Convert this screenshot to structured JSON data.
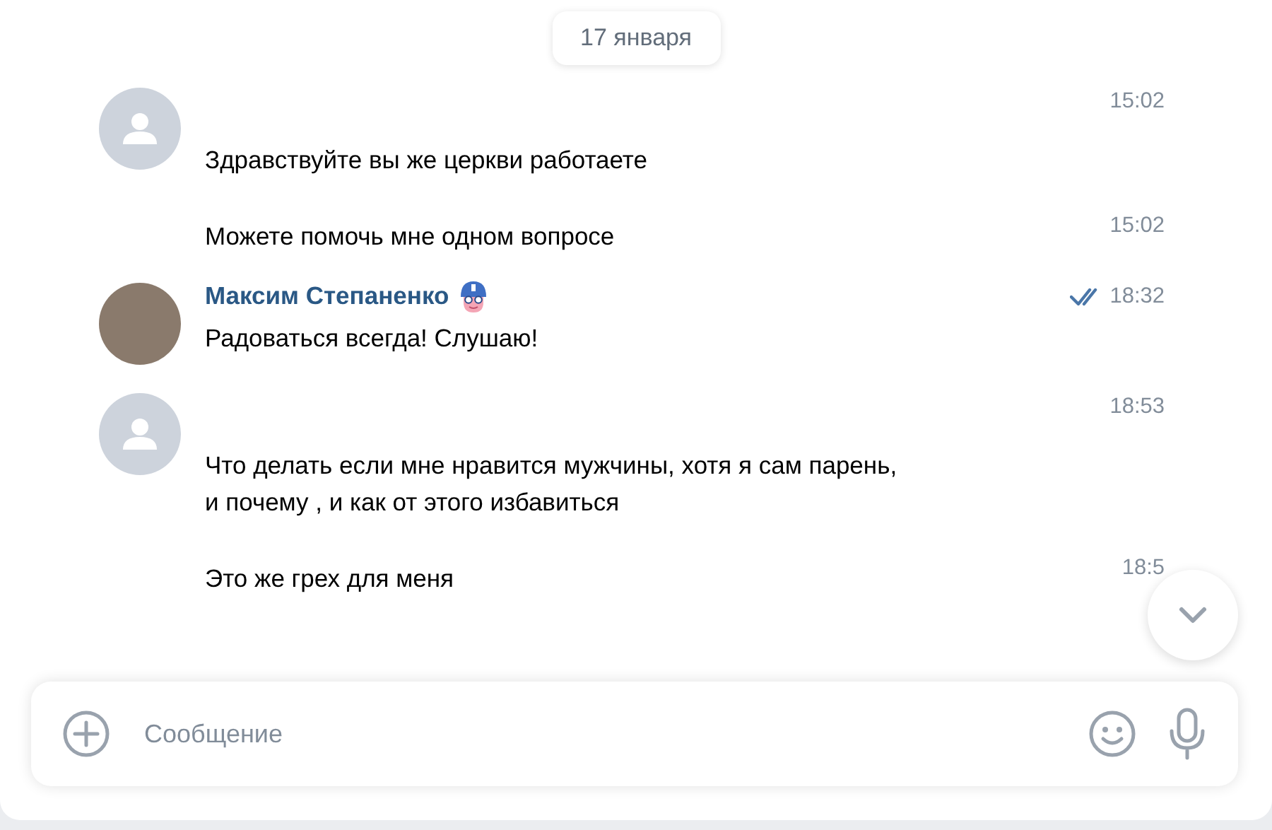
{
  "date": "17 января",
  "groups": [
    {
      "avatar": {
        "kind": "default"
      },
      "messages": [
        {
          "time": "15:02",
          "text": "Здравствуйте вы же церкви работаете"
        },
        {
          "time": "15:02",
          "text": "Можете помочь мне одном вопросе"
        }
      ]
    },
    {
      "avatar": {
        "kind": "photo"
      },
      "sender": "Максим Степаненко",
      "read": true,
      "messages": [
        {
          "time": "18:32",
          "text": "Радоваться всегда! Слушаю!"
        }
      ]
    },
    {
      "avatar": {
        "kind": "default"
      },
      "messages": [
        {
          "time": "18:53",
          "text": "Что делать если мне нравится мужчины, хотя я сам парень,\nи почему , и как от этого избавиться"
        },
        {
          "time": "18:5",
          "text": "Это же грех для меня"
        }
      ]
    }
  ],
  "composer": {
    "placeholder": "Сообщение"
  }
}
